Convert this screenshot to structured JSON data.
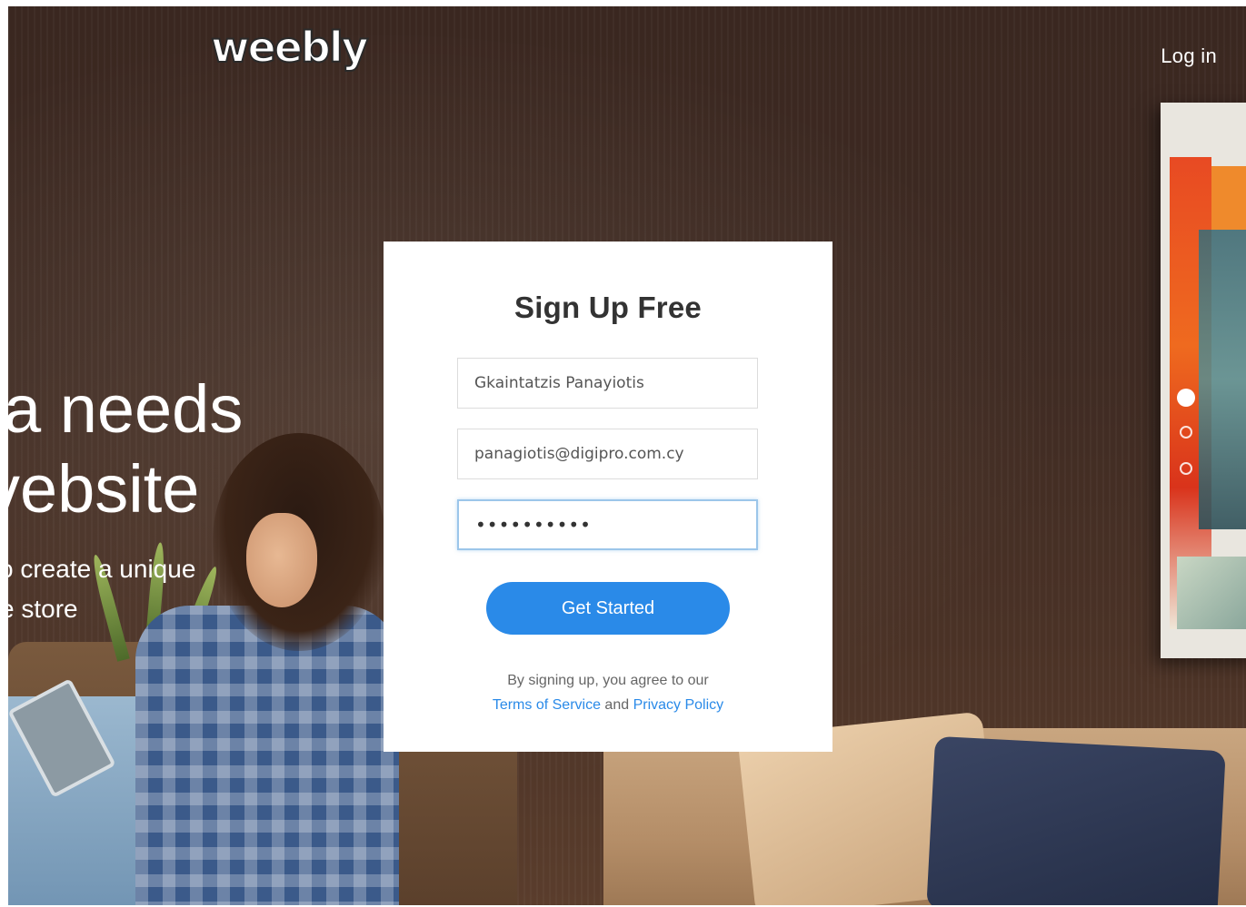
{
  "header": {
    "logo_text": "weebly",
    "login_label": "Log in"
  },
  "hero": {
    "line1": "a needs",
    "line2": "vebsite",
    "sub1": "o create a unique",
    "sub2": "e store"
  },
  "carousel": {
    "slide_count": 3,
    "active_index": 0
  },
  "signup": {
    "title": "Sign Up Free",
    "name_value": "Gkaintatzis Panayiotis",
    "email_value": "panagiotis@digipro.com.cy",
    "password_masked": "••••••••••",
    "submit_label": "Get Started",
    "legal_prefix": "By signing up, you agree to our",
    "terms_label": "Terms of Service",
    "legal_and": "and",
    "privacy_label": "Privacy Policy"
  },
  "colors": {
    "accent": "#2a8ae8",
    "card_bg": "#ffffff",
    "title_text": "#333333"
  }
}
